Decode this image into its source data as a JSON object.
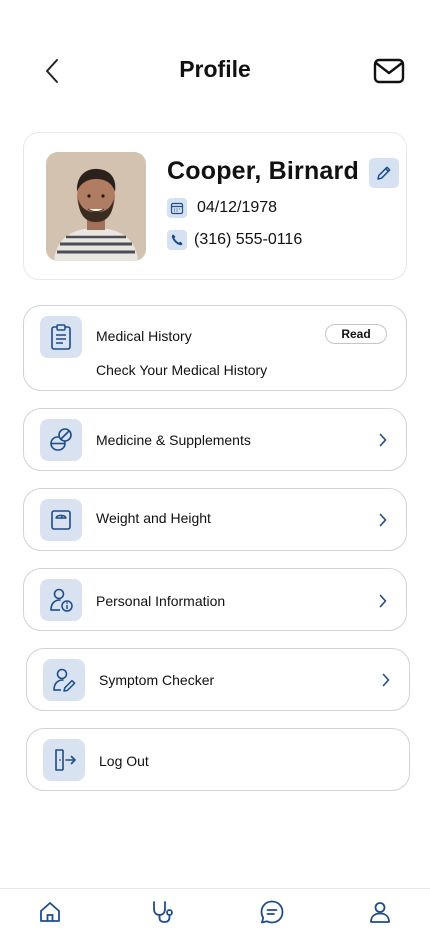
{
  "header": {
    "title": "Profile",
    "back_icon": "chevron-left-icon",
    "mail_icon": "envelope-icon"
  },
  "profile": {
    "name": "Cooper, Birnard",
    "dob": "04/12/1978",
    "phone": "(316) 555-0116",
    "edit_icon": "pencil-icon"
  },
  "menu": {
    "medical_history": {
      "label": "Medical History",
      "badge": "Read",
      "subtitle": "Check Your Medical History",
      "icon": "clipboard-icon"
    },
    "medicine": {
      "label": "Medicine & Supplements",
      "icon": "pills-icon"
    },
    "weight": {
      "label": "Weight and Height",
      "icon": "scale-icon"
    },
    "personal": {
      "label": "Personal Information",
      "icon": "user-info-icon"
    },
    "symptom": {
      "label": "Symptom Checker",
      "icon": "user-edit-icon"
    },
    "logout": {
      "label": "Log Out",
      "icon": "logout-icon"
    }
  },
  "bottom_nav": [
    "home-icon",
    "stethoscope-icon",
    "chat-icon",
    "profile-icon"
  ],
  "colors": {
    "accent": "#1e4d8c",
    "icon_bg": "#d8e2f0",
    "border": "#cfd3d9"
  }
}
